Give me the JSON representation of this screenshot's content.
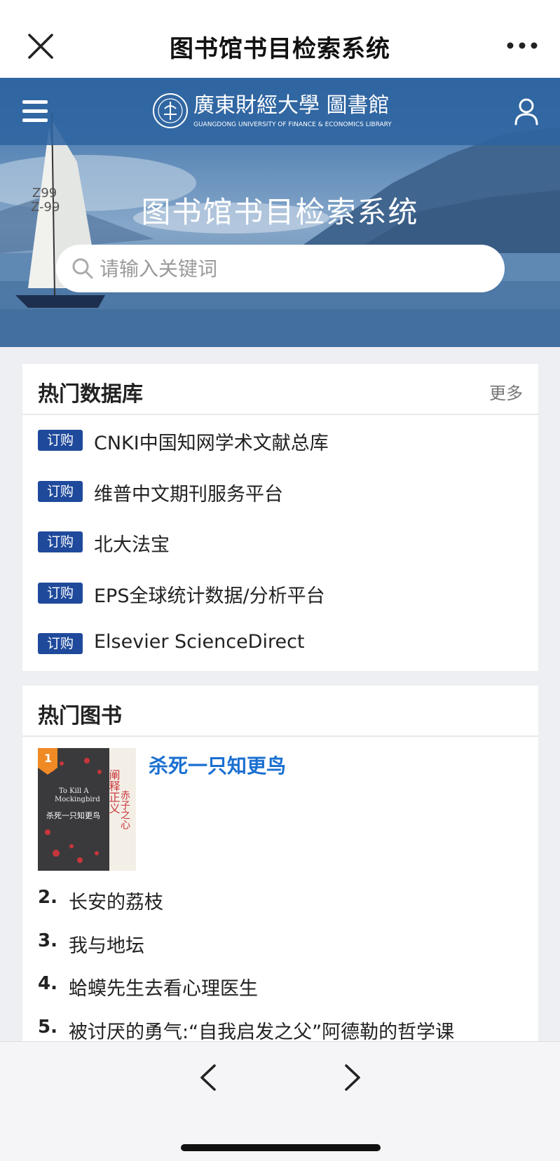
{
  "app": {
    "title": "图书馆书目检索系统"
  },
  "hero": {
    "logo_school": "广东财经大学 图书馆",
    "logo_sub": "GUANGDONG UNIVERSITY OF FINANCE & ECONOMICS LIBRARY",
    "title": "图书馆书目检索系统",
    "search_placeholder": "请输入关键词"
  },
  "databases": {
    "heading": "热门数据库",
    "more": "更多",
    "items": [
      {
        "badge": "订购",
        "name": "CNKI中国知网学术文献总库"
      },
      {
        "badge": "订购",
        "name": "维普中文期刊服务平台"
      },
      {
        "badge": "订购",
        "name": "北大法宝"
      },
      {
        "badge": "订购",
        "name": "EPS全球统计数据/分析平台"
      },
      {
        "badge": "订购",
        "name": "Elsevier ScienceDirect"
      }
    ]
  },
  "books": {
    "heading": "热门图书",
    "top": {
      "rank": "1",
      "title": "杀死一只知更鸟",
      "cover_title_en": "To Kill A Mockingbird",
      "cover_title_cn": "杀死一只知更鸟",
      "cover_slogan": "阐释正义 勇气 赤子之心"
    },
    "items": [
      {
        "rank": "2.",
        "title": "长安的荔枝"
      },
      {
        "rank": "3.",
        "title": "我与地坛"
      },
      {
        "rank": "4.",
        "title": "蛤蟆先生去看心理医生"
      },
      {
        "rank": "5.",
        "title": "被讨厌的勇气:“自我启发之父”阿德勒的哲学课"
      }
    ]
  },
  "colors": {
    "badge": "#1f4a9c",
    "link": "#1a6fd1",
    "accent": "#f08a24",
    "nav": "#2e64a0"
  },
  "icons": [
    "close-icon",
    "more-icon",
    "menu-icon",
    "user-icon",
    "search-icon",
    "back-icon",
    "forward-icon"
  ]
}
